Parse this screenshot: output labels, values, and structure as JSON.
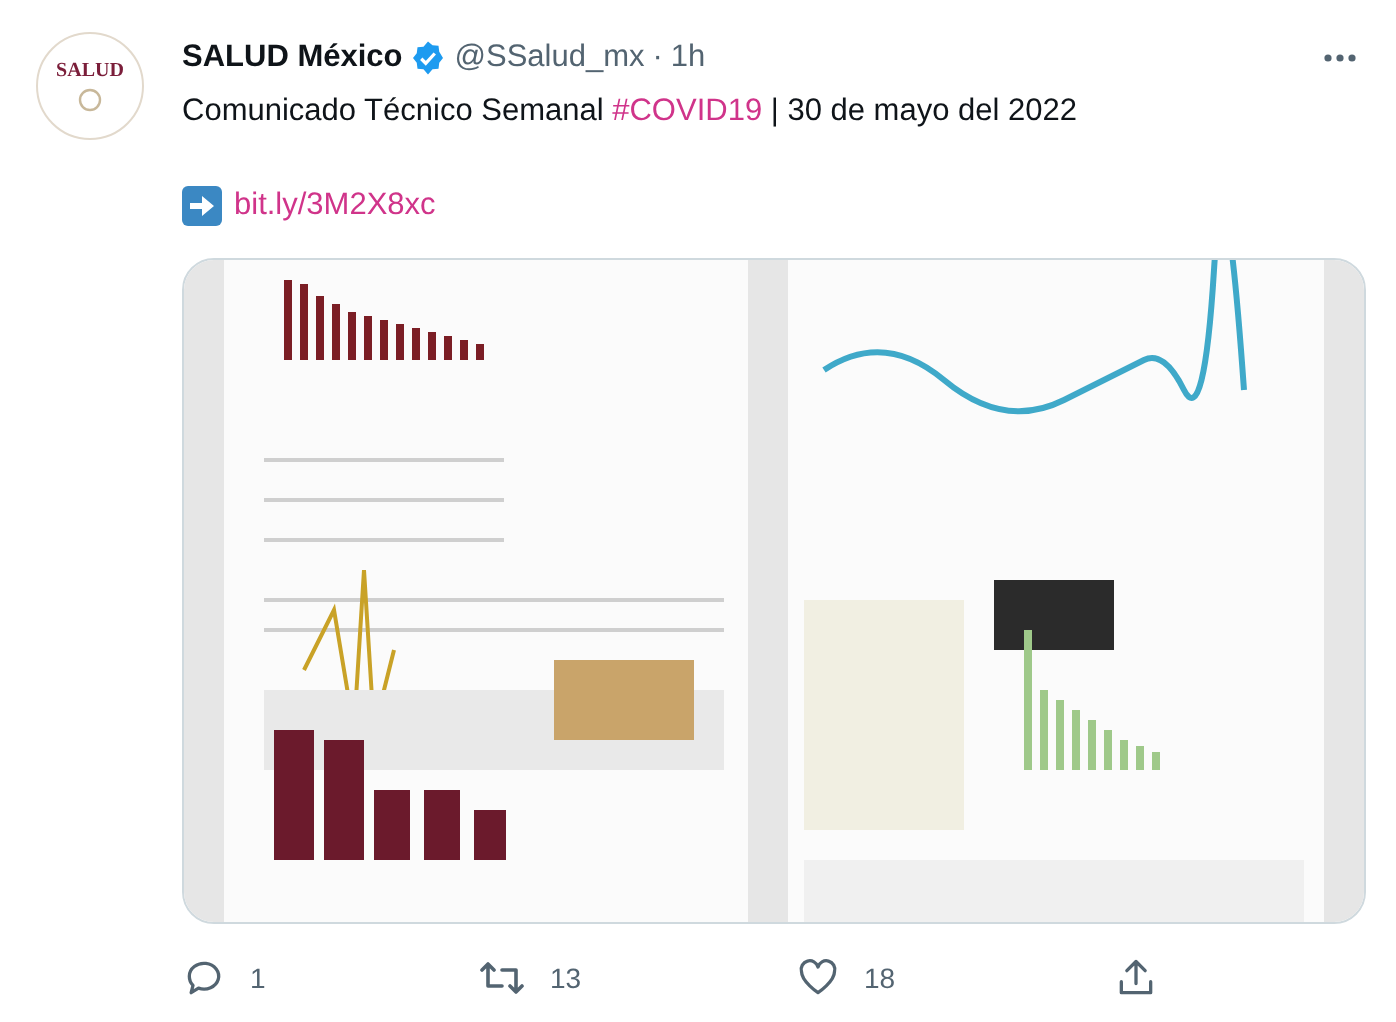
{
  "avatar": {
    "text": "SALUD"
  },
  "author": {
    "name": "SALUD México",
    "verified": true,
    "handle": "@SSalud_mx",
    "separator": "·",
    "time": "1h"
  },
  "text": {
    "prefix": "Comunicado Técnico Semanal ",
    "hashtag": "#COVID19",
    "suffix": " | 30 de mayo del 2022"
  },
  "link": {
    "url": "bit.ly/3M2X8xc"
  },
  "actions": [
    {
      "kind": "reply",
      "count": "1"
    },
    {
      "kind": "retweet",
      "count": "13"
    },
    {
      "kind": "like",
      "count": "18"
    },
    {
      "kind": "share"
    }
  ]
}
